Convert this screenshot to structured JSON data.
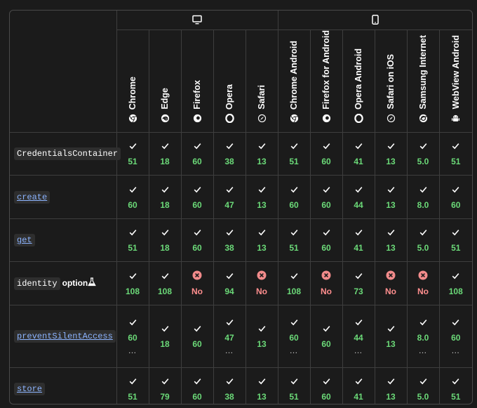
{
  "platforms": [
    {
      "name": "desktop",
      "icon": "desktop-icon",
      "span": 5
    },
    {
      "name": "mobile",
      "icon": "mobile-icon",
      "span": 6
    }
  ],
  "browsers": [
    {
      "name": "Chrome",
      "icon": "chrome-icon"
    },
    {
      "name": "Edge",
      "icon": "edge-icon"
    },
    {
      "name": "Firefox",
      "icon": "firefox-icon"
    },
    {
      "name": "Opera",
      "icon": "opera-icon"
    },
    {
      "name": "Safari",
      "icon": "safari-icon"
    },
    {
      "name": "Chrome Android",
      "icon": "chrome-icon"
    },
    {
      "name": "Firefox for Android",
      "icon": "firefox-icon"
    },
    {
      "name": "Opera Android",
      "icon": "opera-icon"
    },
    {
      "name": "Safari on iOS",
      "icon": "safari-icon"
    },
    {
      "name": "Samsung Internet",
      "icon": "samsung-internet-icon"
    },
    {
      "name": "WebView Android",
      "icon": "android-icon"
    }
  ],
  "features": [
    {
      "name": "CredentialsContainer",
      "link": false,
      "extra": "",
      "cells": [
        {
          "s": "yes",
          "v": "51"
        },
        {
          "s": "yes",
          "v": "18"
        },
        {
          "s": "yes",
          "v": "60"
        },
        {
          "s": "yes",
          "v": "38"
        },
        {
          "s": "yes",
          "v": "13"
        },
        {
          "s": "yes",
          "v": "51"
        },
        {
          "s": "yes",
          "v": "60"
        },
        {
          "s": "yes",
          "v": "41"
        },
        {
          "s": "yes",
          "v": "13"
        },
        {
          "s": "yes",
          "v": "5.0"
        },
        {
          "s": "yes",
          "v": "51"
        }
      ]
    },
    {
      "name": "create",
      "link": true,
      "extra": "",
      "cells": [
        {
          "s": "yes",
          "v": "60"
        },
        {
          "s": "yes",
          "v": "18"
        },
        {
          "s": "yes",
          "v": "60"
        },
        {
          "s": "yes",
          "v": "47"
        },
        {
          "s": "yes",
          "v": "13"
        },
        {
          "s": "yes",
          "v": "60"
        },
        {
          "s": "yes",
          "v": "60"
        },
        {
          "s": "yes",
          "v": "44"
        },
        {
          "s": "yes",
          "v": "13"
        },
        {
          "s": "yes",
          "v": "8.0"
        },
        {
          "s": "yes",
          "v": "60"
        }
      ]
    },
    {
      "name": "get",
      "link": true,
      "extra": "",
      "cells": [
        {
          "s": "yes",
          "v": "51"
        },
        {
          "s": "yes",
          "v": "18"
        },
        {
          "s": "yes",
          "v": "60"
        },
        {
          "s": "yes",
          "v": "38"
        },
        {
          "s": "yes",
          "v": "13"
        },
        {
          "s": "yes",
          "v": "51"
        },
        {
          "s": "yes",
          "v": "60"
        },
        {
          "s": "yes",
          "v": "41"
        },
        {
          "s": "yes",
          "v": "13"
        },
        {
          "s": "yes",
          "v": "5.0"
        },
        {
          "s": "yes",
          "v": "51"
        }
      ]
    },
    {
      "name": "identity",
      "link": false,
      "extra": "option",
      "flask": true,
      "bar": true,
      "cells": [
        {
          "s": "yes",
          "v": "108"
        },
        {
          "s": "yes",
          "v": "108"
        },
        {
          "s": "no",
          "v": "No"
        },
        {
          "s": "yes",
          "v": "94"
        },
        {
          "s": "no",
          "v": "No"
        },
        {
          "s": "yes",
          "v": "108"
        },
        {
          "s": "no",
          "v": "No"
        },
        {
          "s": "yes",
          "v": "73"
        },
        {
          "s": "no",
          "v": "No"
        },
        {
          "s": "no",
          "v": "No"
        },
        {
          "s": "yes",
          "v": "108"
        }
      ]
    },
    {
      "name": "preventSilentAccess",
      "link": true,
      "extra": "",
      "cells": [
        {
          "s": "yes",
          "v": "60",
          "d": true
        },
        {
          "s": "yes",
          "v": "18"
        },
        {
          "s": "yes",
          "v": "60"
        },
        {
          "s": "yes",
          "v": "47",
          "d": true
        },
        {
          "s": "yes",
          "v": "13"
        },
        {
          "s": "yes",
          "v": "60",
          "d": true
        },
        {
          "s": "yes",
          "v": "60"
        },
        {
          "s": "yes",
          "v": "44",
          "d": true
        },
        {
          "s": "yes",
          "v": "13"
        },
        {
          "s": "yes",
          "v": "8.0",
          "d": true
        },
        {
          "s": "yes",
          "v": "60",
          "d": true
        }
      ]
    },
    {
      "name": "store",
      "link": true,
      "extra": "",
      "cells": [
        {
          "s": "yes",
          "v": "51"
        },
        {
          "s": "yes",
          "v": "79"
        },
        {
          "s": "yes",
          "v": "60"
        },
        {
          "s": "yes",
          "v": "38"
        },
        {
          "s": "yes",
          "v": "13"
        },
        {
          "s": "yes",
          "v": "51"
        },
        {
          "s": "yes",
          "v": "60"
        },
        {
          "s": "yes",
          "v": "41"
        },
        {
          "s": "yes",
          "v": "13"
        },
        {
          "s": "yes",
          "v": "5.0"
        },
        {
          "s": "yes",
          "v": "51"
        }
      ]
    }
  ],
  "symbols": {
    "yes": "✓",
    "more": "…"
  },
  "colors": {
    "yes": "#6bd978",
    "no": "#ff8e8e",
    "no_icon": "#f28b8b",
    "link": "#8cb4ff"
  }
}
